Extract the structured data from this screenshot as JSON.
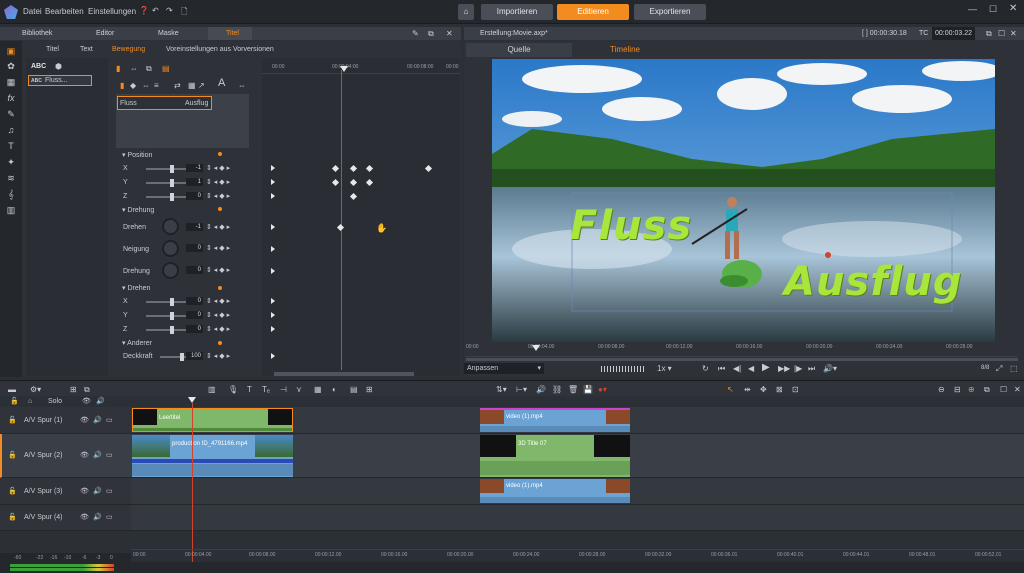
{
  "menu": {
    "file": "Datei",
    "edit": "Bearbeiten",
    "settings": "Einstellungen",
    "help": "?"
  },
  "topnav": {
    "import": "Importieren",
    "edit": "Editieren",
    "export": "Exportieren"
  },
  "left_header_tabs": {
    "library": "Bibliothek",
    "editor": "Editor",
    "mask": "Maske",
    "title": "Titel"
  },
  "subtabs": {
    "title": "Titel",
    "text": "Text",
    "motion": "Bewegung",
    "presets": "Voreinstellungen aus Vorversionen"
  },
  "title_list": {
    "abc": "ABC",
    "item1": "ABC",
    "item1_name": "Fluss..."
  },
  "text_layers": {
    "left": "Fluss",
    "right": "Ausflug"
  },
  "sections": {
    "position": "Position",
    "rotation": "Drehung",
    "flip": "Drehen",
    "other": "Anderer"
  },
  "props": {
    "x": "X",
    "y": "Y",
    "z": "Z",
    "rotate": "Drehen",
    "tilt": "Neigung",
    "turn": "Drehung",
    "fx": "X",
    "fy": "Y",
    "fz": "Z",
    "opacity": "Deckkraft"
  },
  "values": {
    "x": "-1",
    "y": "1",
    "z": "0",
    "rotate": "-1",
    "tilt": "0",
    "turn": "0",
    "fx": "0",
    "fy": "0",
    "fz": "0",
    "opacity": "100"
  },
  "kf_ruler": {
    "t0": "00:00",
    "t1": "00:00:04:00",
    "t2": "00:00:08:00",
    "t3": "00:00"
  },
  "preview": {
    "file": "Erstellung:Movie.axp*",
    "timecode": "00:00:30.18",
    "tc_label": "TC",
    "tc": "00:00:03.22",
    "tab_source": "Quelle",
    "tab_timeline": "Timeline",
    "fit": "Anpassen",
    "speed": "1x",
    "ruler": [
      "00:00",
      "00:00:04.00",
      "00:00:08.00",
      "00:00:12.00",
      "00:00:16.00",
      "00:00:20.00",
      "00:00:24.00",
      "00:00:28.00"
    ]
  },
  "overlay_text": {
    "left": "Fluss",
    "right": "Ausflug"
  },
  "timeline": {
    "solo": "Solo",
    "tracks": [
      {
        "name": "A/V Spur (1)"
      },
      {
        "name": "A/V Spur (2)"
      },
      {
        "name": "A/V Spur (3)"
      },
      {
        "name": "A/V Spur (4)"
      }
    ],
    "clips": {
      "leertitel": "Leertitel",
      "video1": "video (1).mp4",
      "production": "production ID_4791166.mp4",
      "title3d": "3D Title 07",
      "video3": "video (1).mp4"
    },
    "ruler": [
      "00:00",
      "00:00:04.00",
      "00:00:08.00",
      "00:00:12.00",
      "00:00:16.00",
      "00:00:20.00",
      "00:00:24.00",
      "00:00:28.00",
      "00:00:32.00",
      "00:00:36.01",
      "00:00:40.01",
      "00:00:44.01",
      "00:00:48.01",
      "00:00:52.01"
    ],
    "meter": [
      "-60",
      "-22",
      "-16",
      "-10",
      "-6",
      "-3",
      "0"
    ]
  },
  "colors": {
    "accent": "#f28c1e",
    "title_text": "#a8e63c",
    "clip_green": "#7fb86a",
    "clip_blue": "#6aa3d4",
    "clip_magenta": "#cc44cc"
  }
}
